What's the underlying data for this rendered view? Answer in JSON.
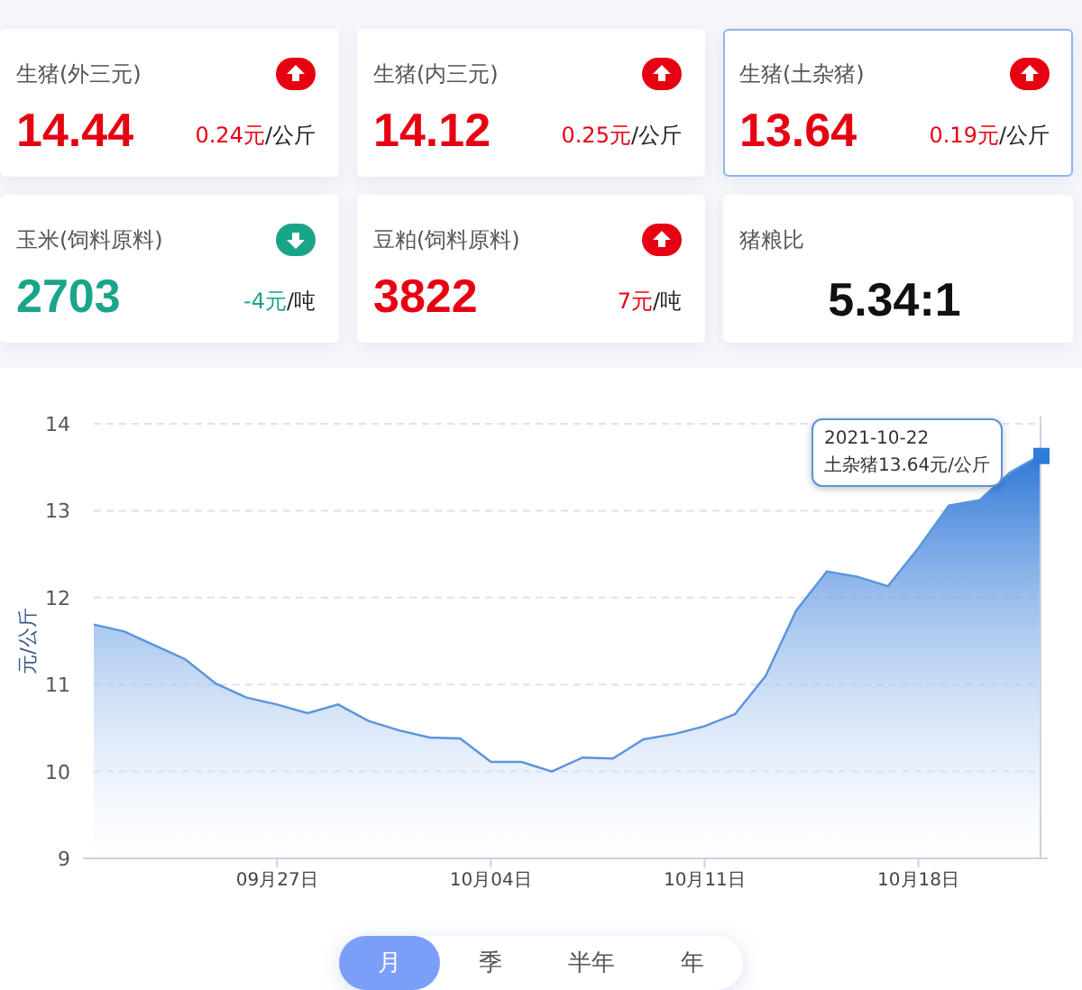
{
  "cards": [
    {
      "kind": "price",
      "title": "生猪(外三元)",
      "rising": true,
      "value": "14.44",
      "change": "0.24元",
      "unit": "/公斤",
      "selected": false
    },
    {
      "kind": "price",
      "title": "生猪(内三元)",
      "rising": true,
      "value": "14.12",
      "change": "0.25元",
      "unit": "/公斤",
      "selected": false
    },
    {
      "kind": "price",
      "title": "生猪(土杂猪)",
      "rising": true,
      "value": "13.64",
      "change": "0.19元",
      "unit": "/公斤",
      "selected": true
    },
    {
      "kind": "price",
      "title": "玉米(饲料原料)",
      "rising": false,
      "value": "2703",
      "change": "-4元",
      "unit": "/吨",
      "selected": false
    },
    {
      "kind": "price",
      "title": "豆粕(饲料原料)",
      "rising": true,
      "value": "3822",
      "change": "7元",
      "unit": "/吨",
      "selected": false
    },
    {
      "kind": "ratio",
      "title": "猪粮比",
      "value": "5.34:1",
      "selected": false
    }
  ],
  "chart": {
    "tooltip": {
      "date": "2021-10-22",
      "text": "土杂猪13.64元/公斤"
    },
    "chart_data": {
      "type": "area",
      "ylabel": "元/公斤",
      "ylim": [
        9,
        14
      ],
      "yticks": [
        9,
        10,
        11,
        12,
        13,
        14
      ],
      "grid": true,
      "categories": [
        null,
        null,
        null,
        null,
        null,
        null,
        "09月27日",
        null,
        null,
        null,
        null,
        null,
        null,
        "10月04日",
        null,
        null,
        null,
        null,
        null,
        null,
        "10月11日",
        null,
        null,
        null,
        null,
        null,
        null,
        "10月18日",
        null,
        null,
        null,
        null
      ],
      "series": [
        {
          "color": "#5b94dd",
          "values": [
            11.69,
            11.61,
            11.45,
            11.29,
            11.01,
            10.85,
            10.77,
            10.67,
            10.77,
            10.58,
            10.47,
            10.39,
            10.38,
            10.11,
            10.11,
            10.0,
            10.16,
            10.15,
            10.37,
            10.43,
            10.52,
            10.66,
            11.1,
            11.85,
            12.3,
            12.24,
            12.13,
            12.57,
            13.06,
            13.12,
            13.44,
            13.64
          ]
        }
      ]
    }
  },
  "periods": [
    {
      "label": "月",
      "selected": true
    },
    {
      "label": "季",
      "selected": false
    },
    {
      "label": "半年",
      "selected": false
    },
    {
      "label": "年",
      "selected": false
    }
  ]
}
